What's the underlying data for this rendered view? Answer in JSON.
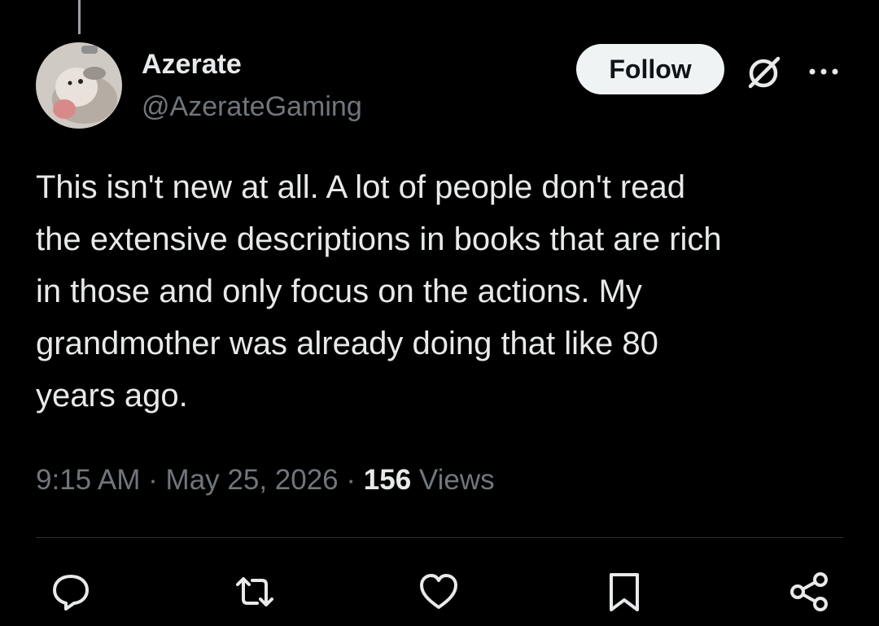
{
  "author": {
    "display_name": "Azerate",
    "handle": "@AzerateGaming",
    "avatar_icon": "hedgehog-avatar"
  },
  "header": {
    "follow_label": "Follow",
    "grok_icon": "grok-icon",
    "more_icon": "more-dots-icon"
  },
  "tweet": {
    "text": "This isn't new at all. A lot of people don't read\nthe extensive descriptions in books that are rich\nin those and only focus on the actions. My\ngrandmother was already doing that like 80\nyears ago."
  },
  "meta": {
    "time": "9:15 AM",
    "separator": "·",
    "date": "May 25, 2026",
    "views_count": "156",
    "views_label": "Views"
  },
  "actions": [
    {
      "name": "reply",
      "icon": "reply-icon"
    },
    {
      "name": "retweet",
      "icon": "retweet-icon"
    },
    {
      "name": "like",
      "icon": "heart-icon"
    },
    {
      "name": "bookmark",
      "icon": "bookmark-icon"
    },
    {
      "name": "share",
      "icon": "share-icon"
    }
  ],
  "colors": {
    "background": "#000000",
    "primary_text": "#e7e9ea",
    "secondary_text": "#71767b",
    "follow_bg": "#eff3f4",
    "divider": "#2f3336"
  }
}
